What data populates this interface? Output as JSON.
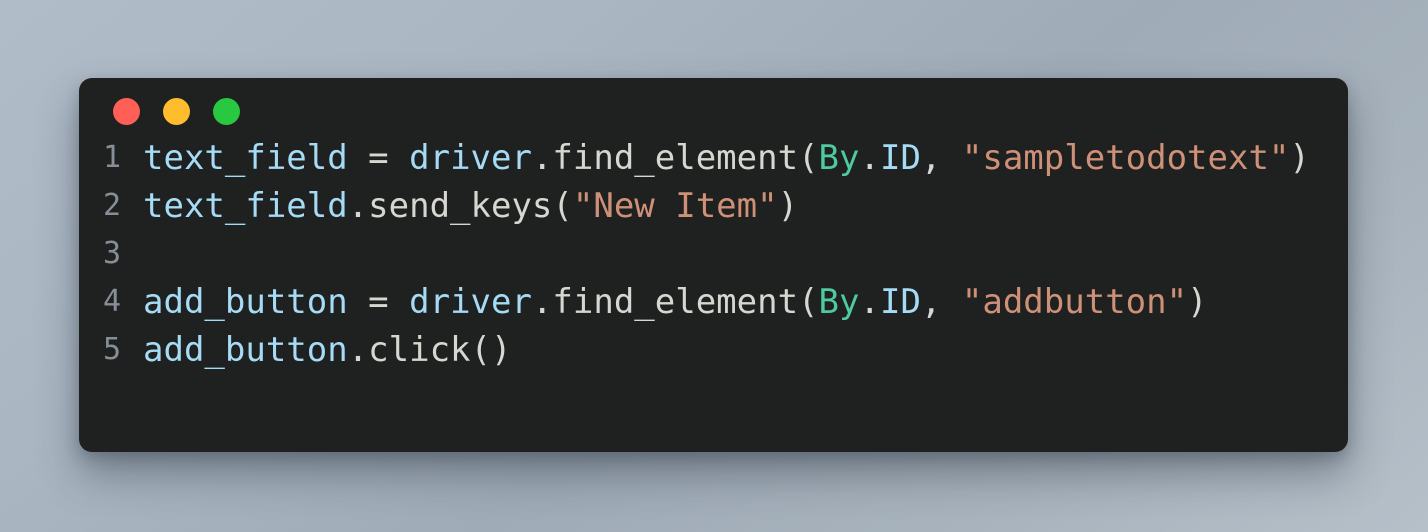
{
  "window": {
    "controls": [
      {
        "name": "close",
        "label": "Close",
        "color": "#ff5f57"
      },
      {
        "name": "minimize",
        "label": "Minimize",
        "color": "#ffbd2e"
      },
      {
        "name": "zoom",
        "label": "Zoom",
        "color": "#28c840"
      }
    ],
    "background": "#1f2020"
  },
  "theme": {
    "page_background_start": "#b0bcc8",
    "page_background_end": "#b6c0c9",
    "line_number_color": "#868e96",
    "variable_color": "#a6dbf5",
    "plain_color": "#d7d7d1",
    "class_color": "#4ec9a0",
    "string_color": "#ce9178"
  },
  "code": {
    "language": "python",
    "lines": [
      {
        "number": "1",
        "text": "text_field = driver.find_element(By.ID, \"sampletodotext\")",
        "tokens": [
          {
            "text": "text_field",
            "type": "var"
          },
          {
            "text": " = ",
            "type": "plain"
          },
          {
            "text": "driver",
            "type": "var"
          },
          {
            "text": ".find_element(",
            "type": "plain"
          },
          {
            "text": "By",
            "type": "class"
          },
          {
            "text": ".",
            "type": "punct"
          },
          {
            "text": "ID",
            "type": "prop"
          },
          {
            "text": ", ",
            "type": "plain"
          },
          {
            "text": "\"sampletodotext\"",
            "type": "string"
          },
          {
            "text": ")",
            "type": "punct"
          }
        ]
      },
      {
        "number": "2",
        "text": "text_field.send_keys(\"New Item\")",
        "tokens": [
          {
            "text": "text_field",
            "type": "var"
          },
          {
            "text": ".send_keys(",
            "type": "plain"
          },
          {
            "text": "\"New Item\"",
            "type": "string"
          },
          {
            "text": ")",
            "type": "punct"
          }
        ]
      },
      {
        "number": "3",
        "text": "",
        "tokens": []
      },
      {
        "number": "4",
        "text": "add_button = driver.find_element(By.ID, \"addbutton\")",
        "tokens": [
          {
            "text": "add_button",
            "type": "var"
          },
          {
            "text": " = ",
            "type": "plain"
          },
          {
            "text": "driver",
            "type": "var"
          },
          {
            "text": ".find_element(",
            "type": "plain"
          },
          {
            "text": "By",
            "type": "class"
          },
          {
            "text": ".",
            "type": "punct"
          },
          {
            "text": "ID",
            "type": "prop"
          },
          {
            "text": ", ",
            "type": "plain"
          },
          {
            "text": "\"addbutton\"",
            "type": "string"
          },
          {
            "text": ")",
            "type": "punct"
          }
        ]
      },
      {
        "number": "5",
        "text": "add_button.click()",
        "tokens": [
          {
            "text": "add_button",
            "type": "var"
          },
          {
            "text": ".click()",
            "type": "plain"
          }
        ]
      }
    ]
  }
}
